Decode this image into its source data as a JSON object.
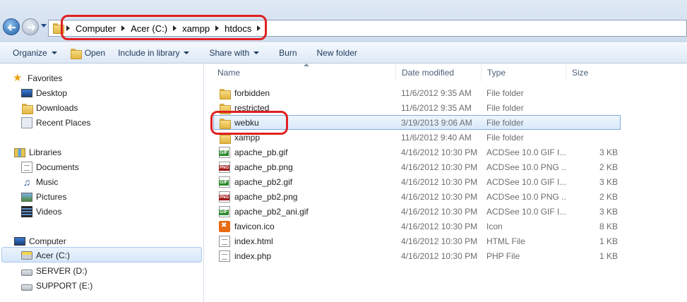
{
  "address_bar": {
    "breadcrumb": [
      "Computer",
      "Acer (C:)",
      "xampp",
      "htdocs"
    ]
  },
  "toolbar": {
    "organize": "Organize",
    "open": "Open",
    "include_in_library": "Include in library",
    "share_with": "Share with",
    "burn": "Burn",
    "new_folder": "New folder"
  },
  "nav": {
    "favorites": {
      "label": "Favorites",
      "items": [
        {
          "label": "Desktop",
          "icon": "desktop-icon"
        },
        {
          "label": "Downloads",
          "icon": "downloads-icon"
        },
        {
          "label": "Recent Places",
          "icon": "recent-places-icon"
        }
      ]
    },
    "libraries": {
      "label": "Libraries",
      "items": [
        {
          "label": "Documents",
          "icon": "documents-icon"
        },
        {
          "label": "Music",
          "icon": "music-icon"
        },
        {
          "label": "Pictures",
          "icon": "pictures-icon"
        },
        {
          "label": "Videos",
          "icon": "videos-icon"
        }
      ]
    },
    "computer": {
      "label": "Computer",
      "items": [
        {
          "label": "Acer (C:)",
          "icon": "drive-c-icon",
          "selected": true
        },
        {
          "label": "SERVER (D:)",
          "icon": "drive-icon"
        },
        {
          "label": "SUPPORT (E:)",
          "icon": "drive-icon"
        }
      ]
    }
  },
  "columns": {
    "name": "Name",
    "date": "Date modified",
    "type": "Type",
    "size": "Size"
  },
  "files": [
    {
      "name": "forbidden",
      "date": "11/6/2012 9:35 AM",
      "type": "File folder",
      "size": "",
      "icon": "folder-icon"
    },
    {
      "name": "restricted",
      "date": "11/6/2012 9:35 AM",
      "type": "File folder",
      "size": "",
      "icon": "folder-icon"
    },
    {
      "name": "webku",
      "date": "3/19/2013 9:06 AM",
      "type": "File folder",
      "size": "",
      "icon": "folder-icon",
      "selected": true
    },
    {
      "name": "xampp",
      "date": "11/6/2012 9:40 AM",
      "type": "File folder",
      "size": "",
      "icon": "folder-icon"
    },
    {
      "name": "apache_pb.gif",
      "date": "4/16/2012 10:30 PM",
      "type": "ACDSee 10.0 GIF I...",
      "size": "3 KB",
      "icon": "gif-icon"
    },
    {
      "name": "apache_pb.png",
      "date": "4/16/2012 10:30 PM",
      "type": "ACDSee 10.0 PNG ...",
      "size": "2 KB",
      "icon": "png-icon"
    },
    {
      "name": "apache_pb2.gif",
      "date": "4/16/2012 10:30 PM",
      "type": "ACDSee 10.0 GIF I...",
      "size": "3 KB",
      "icon": "gif-icon"
    },
    {
      "name": "apache_pb2.png",
      "date": "4/16/2012 10:30 PM",
      "type": "ACDSee 10.0 PNG ...",
      "size": "2 KB",
      "icon": "png-icon"
    },
    {
      "name": "apache_pb2_ani.gif",
      "date": "4/16/2012 10:30 PM",
      "type": "ACDSee 10.0 GIF I...",
      "size": "3 KB",
      "icon": "gif-icon"
    },
    {
      "name": "favicon.ico",
      "date": "4/16/2012 10:30 PM",
      "type": "Icon",
      "size": "8 KB",
      "icon": "ico-icon"
    },
    {
      "name": "index.html",
      "date": "4/16/2012 10:30 PM",
      "type": "HTML File",
      "size": "1 KB",
      "icon": "html-file-icon"
    },
    {
      "name": "index.php",
      "date": "4/16/2012 10:30 PM",
      "type": "PHP File",
      "size": "1 KB",
      "icon": "php-file-icon"
    }
  ],
  "colors": {
    "highlight": "#e02020",
    "selection": "#d9e9fb",
    "toolbar_text": "#1e395b"
  }
}
